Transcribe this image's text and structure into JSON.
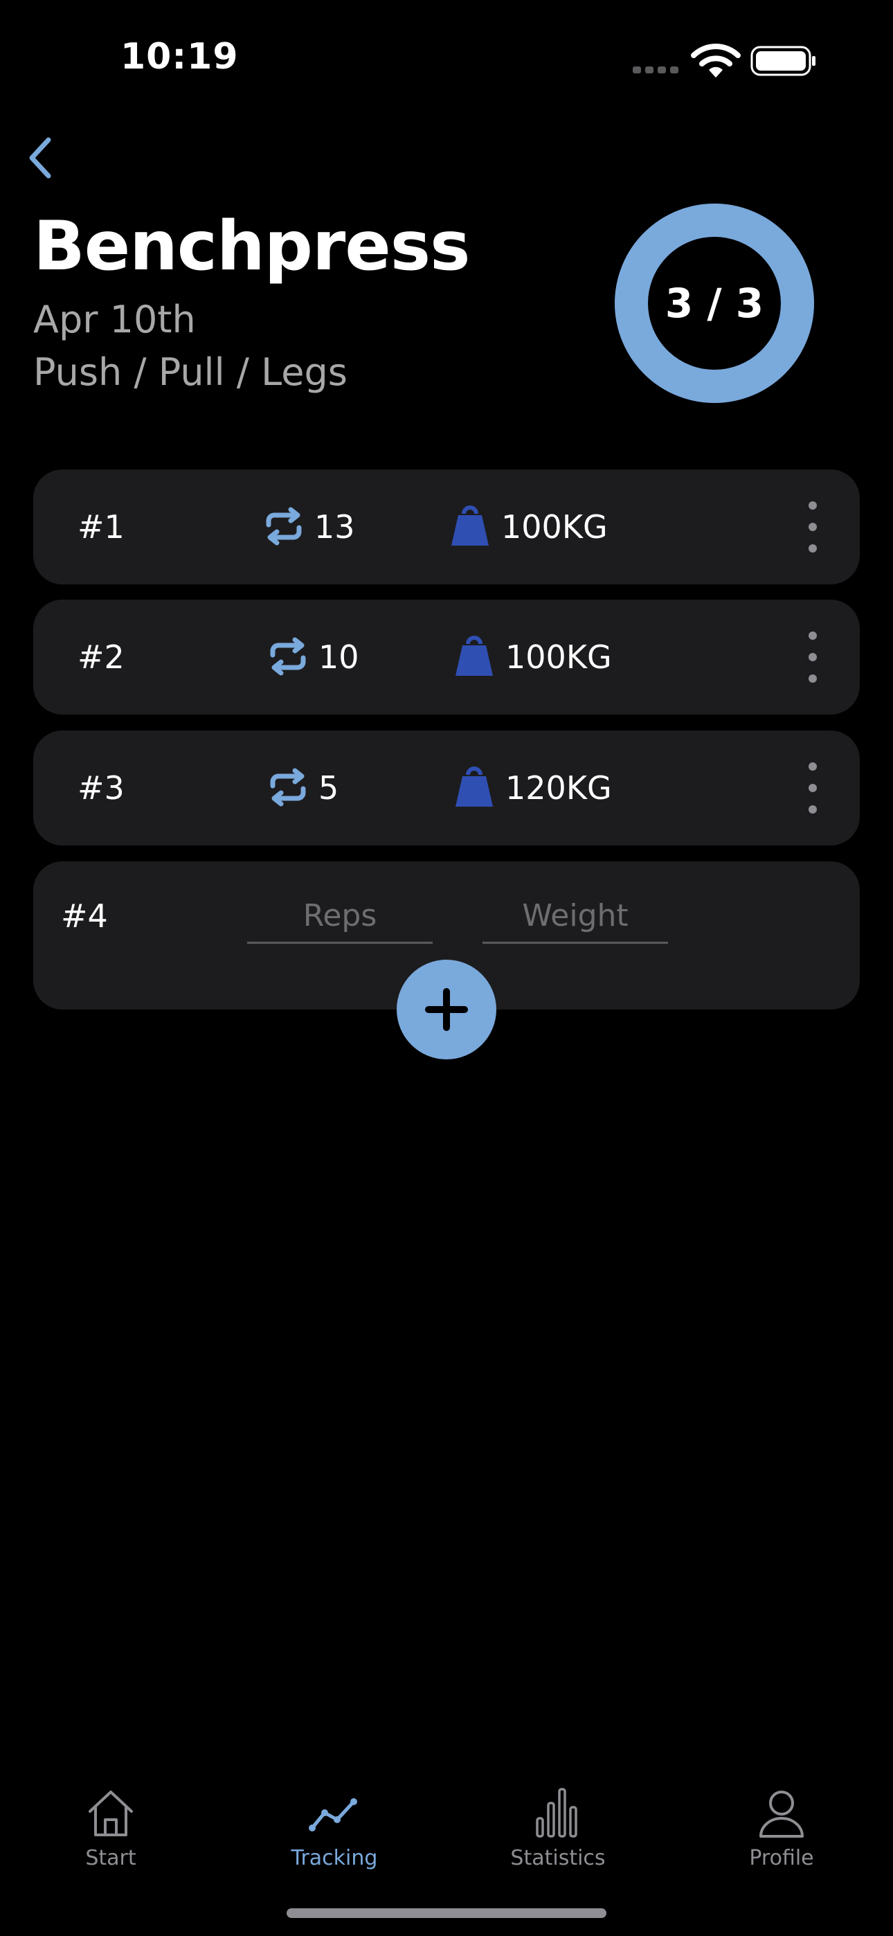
{
  "status_bar": {
    "time": "10:19"
  },
  "workout": {
    "exercise": "Benchpress",
    "date": "Apr 10th",
    "plan": "Push / Pull / Legs",
    "progress_label": "3 / 3",
    "progress_fraction": 1.0
  },
  "sets": [
    {
      "number": "#1",
      "reps": "13",
      "weight": "100",
      "unit": "KG"
    },
    {
      "number": "#2",
      "reps": "10",
      "weight": "100",
      "unit": "KG"
    },
    {
      "number": "#3",
      "reps": "5",
      "weight": "120",
      "unit": "KG"
    }
  ],
  "new_set": {
    "number": "#4",
    "reps_placeholder": "Reps",
    "weight_placeholder": "Weight"
  },
  "tabs": [
    {
      "label": "Start",
      "icon": "home-icon",
      "active": false
    },
    {
      "label": "Tracking",
      "icon": "chart-line-icon",
      "active": true
    },
    {
      "label": "Statistics",
      "icon": "bar-chart-icon",
      "active": false
    },
    {
      "label": "Profile",
      "icon": "person-icon",
      "active": false
    }
  ],
  "colors": {
    "accent": "#7aa9dc",
    "weight_icon": "#2f4fb3",
    "card": "#1c1c1e",
    "background": "#000000",
    "muted_text": "#a8a8a8"
  }
}
